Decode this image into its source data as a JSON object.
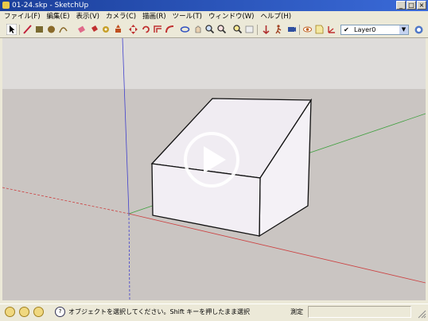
{
  "window": {
    "title": "01-24.skp - SketchUp",
    "buttons": [
      "_",
      "□",
      "×"
    ]
  },
  "menu": [
    "ファイル(F)",
    "編集(E)",
    "表示(V)",
    "カメラ(C)",
    "描画(R)",
    "ツール(T)",
    "ウィンドウ(W)",
    "ヘルプ(H)"
  ],
  "toolbar": {
    "tools": [
      "select-icon",
      "line-icon",
      "rectangle-icon",
      "circle-icon",
      "arc-icon",
      "eraser-icon",
      "paint-bucket-icon",
      "tape-measure-icon",
      "push-pull-icon",
      "move-icon",
      "rotate-icon",
      "offset-icon",
      "follow-me-icon",
      "orbit-icon",
      "pan-icon",
      "zoom-icon",
      "zoom-window-icon",
      "zoom-extents-icon",
      "previous-view-icon",
      "section-icon",
      "walk-icon",
      "position-camera-icon",
      "look-around-icon",
      "text-icon",
      "axes-icon",
      "dimension-icon"
    ],
    "layer_check": "✔",
    "layer_name": "Layer0",
    "layer_arrow": "▼"
  },
  "colors": {
    "sky": "#dedcda",
    "ground": "#cac5c2",
    "face": "#f2eef4",
    "edge": "#111111",
    "axis_red": "#cc4040",
    "axis_green": "#3fa03f",
    "axis_blue": "#4040cc"
  },
  "viewport": {
    "play_icon": "play-icon"
  },
  "status": {
    "text": "オブジェクトを選択してください。Shift キーを押したまま選択",
    "measure_label": "測定",
    "measure_value": ""
  }
}
